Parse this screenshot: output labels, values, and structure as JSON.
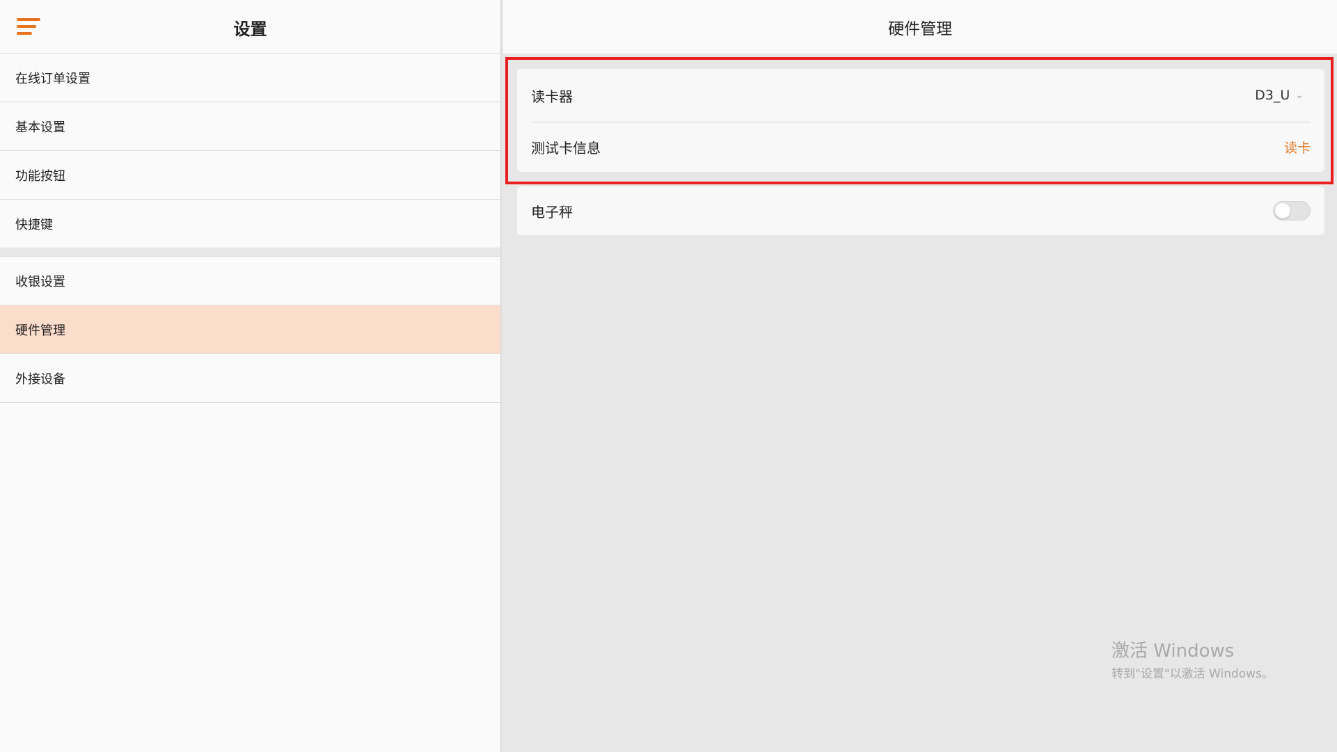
{
  "sidebar": {
    "title": "设置",
    "menu_icon": "hamburger-menu-icon",
    "items_group1": [
      {
        "label": "在线订单设置"
      },
      {
        "label": "基本设置"
      },
      {
        "label": "功能按钮"
      },
      {
        "label": "快捷键"
      }
    ],
    "items_group2": [
      {
        "label": "收银设置"
      },
      {
        "label": "硬件管理",
        "active": true
      },
      {
        "label": "外接设备"
      }
    ]
  },
  "main": {
    "title": "硬件管理",
    "card_reader": {
      "label": "读卡器",
      "value": "D3_U",
      "chevron_icon": "chevron-down-icon"
    },
    "test_card": {
      "label": "测试卡信息",
      "action": "读卡"
    },
    "scale": {
      "label": "电子秤",
      "enabled": false
    }
  },
  "watermark": {
    "line1": "激活 Windows",
    "line2": "转到\"设置\"以激活 Windows。"
  },
  "colors": {
    "accent": "#e8731e",
    "active_bg": "#fcdccb",
    "highlight": "#ea1f1f"
  }
}
